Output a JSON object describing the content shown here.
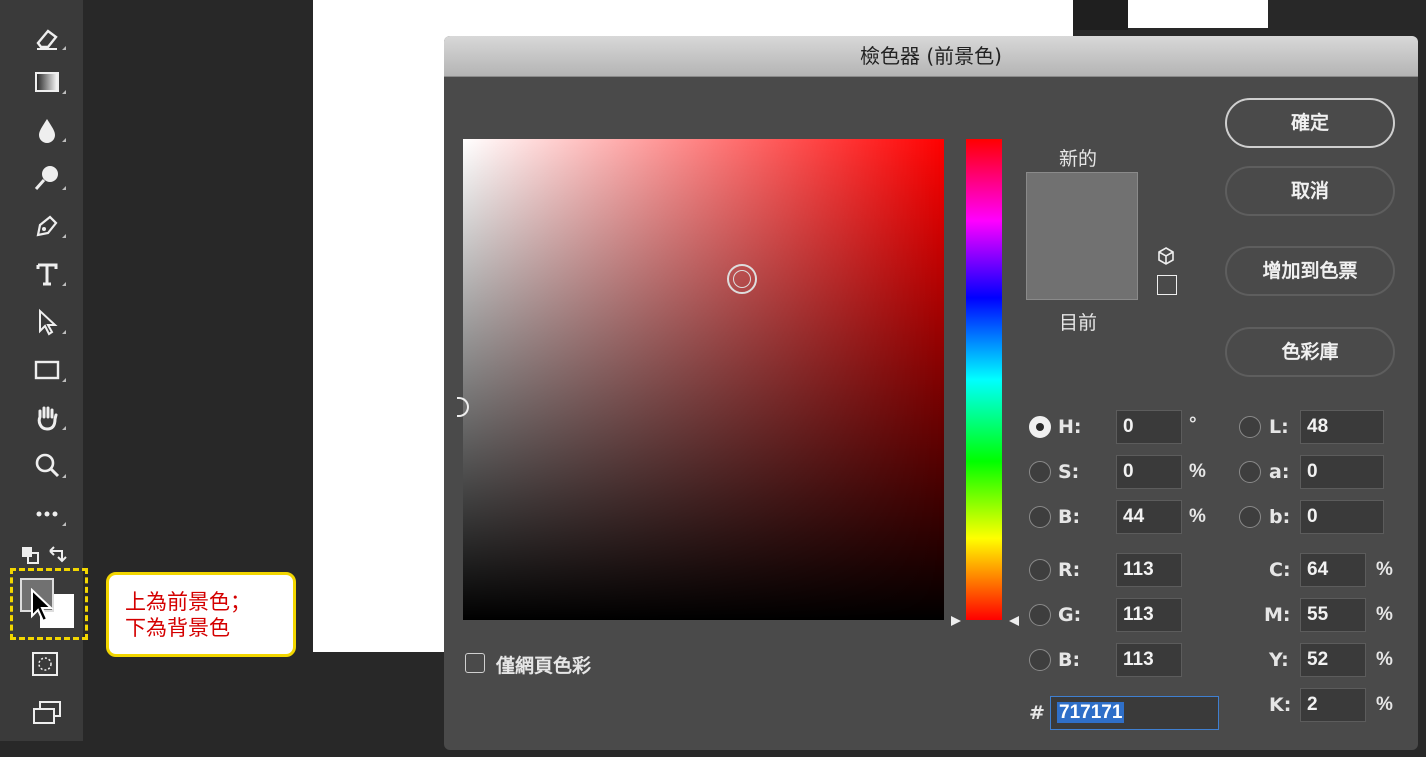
{
  "toolbar": {
    "tools": [
      "eraser-icon",
      "gradient-icon",
      "blur-icon",
      "dodge-icon",
      "pen-icon",
      "type-icon",
      "path-select-icon",
      "rectangle-icon",
      "hand-icon",
      "zoom-icon",
      "more-icon"
    ]
  },
  "annotation": {
    "line1": "上為前景色；",
    "line2": "下為背景色"
  },
  "dialog": {
    "title": "檢色器 (前景色)",
    "new_label": "新的",
    "current_label": "目前",
    "new_color": "#717171",
    "current_color": "#717171",
    "buttons": {
      "ok": "確定",
      "cancel": "取消",
      "add_swatch": "增加到色票",
      "libraries": "色彩庫"
    },
    "web_only_label": "僅網頁色彩",
    "fields": {
      "H": {
        "label": "H:",
        "value": "0",
        "unit": "°",
        "selected": true
      },
      "S": {
        "label": "S:",
        "value": "0",
        "unit": "%"
      },
      "Bv": {
        "label": "B:",
        "value": "44",
        "unit": "%"
      },
      "R": {
        "label": "R:",
        "value": "113"
      },
      "G": {
        "label": "G:",
        "value": "113"
      },
      "B": {
        "label": "B:",
        "value": "113"
      },
      "L": {
        "label": "L:",
        "value": "48"
      },
      "a": {
        "label": "a:",
        "value": "0"
      },
      "b": {
        "label": "b:",
        "value": "0"
      },
      "C": {
        "label": "C:",
        "value": "64",
        "unit": "%"
      },
      "M": {
        "label": "M:",
        "value": "55",
        "unit": "%"
      },
      "Y": {
        "label": "Y:",
        "value": "52",
        "unit": "%"
      },
      "K": {
        "label": "K:",
        "value": "2",
        "unit": "%"
      }
    },
    "hex_label": "#",
    "hex_value": "717171"
  }
}
